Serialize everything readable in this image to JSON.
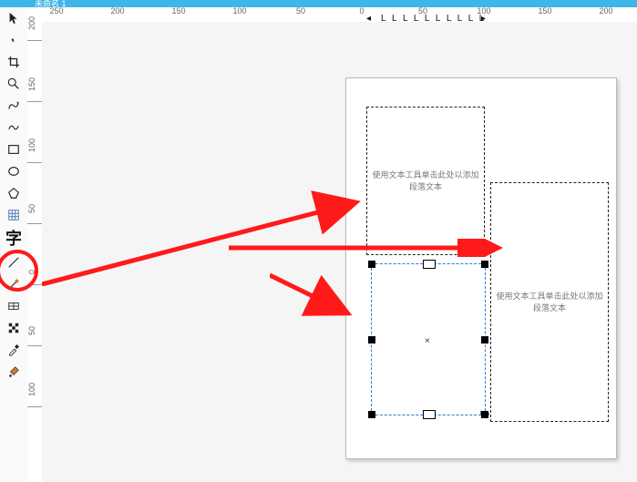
{
  "title_tab": "未命名 1",
  "top_ruler_labels": [
    "250",
    "200",
    "150",
    "100",
    "50",
    "0",
    "50",
    "100",
    "150",
    "200"
  ],
  "ruler_L_marks": "L L L L L L L L L L",
  "left_ruler_labels": [
    "200",
    "150",
    "100",
    "50",
    "0",
    "50",
    "100"
  ],
  "text_frame_placeholder": "使用文本工具单击此处以添加\n段落文本",
  "tools": {
    "pick": "pick-tool-icon",
    "shape_node": "shape-node-icon",
    "crop": "crop-tool-icon",
    "zoom": "zoom-tool-icon",
    "freehand": "freehand-tool-icon",
    "smart_draw": "smart-draw-icon",
    "rectangle": "rectangle-tool-icon",
    "ellipse": "ellipse-tool-icon",
    "polygon": "polygon-tool-icon",
    "grid": "grid-tool-icon",
    "text": "text-tool-icon",
    "line1": "line-tool-icon",
    "line_brush": "brush-tool-icon",
    "mesh": "mesh-fill-icon",
    "checker": "transparency-tool-icon",
    "eyedrop": "eyedropper-icon",
    "fill": "interactive-fill-icon"
  },
  "text_glyph": "字",
  "center_glyph": "×",
  "stairs_glyph": "⌙",
  "arrow_marker_glyph": "◂",
  "chart_data": null
}
